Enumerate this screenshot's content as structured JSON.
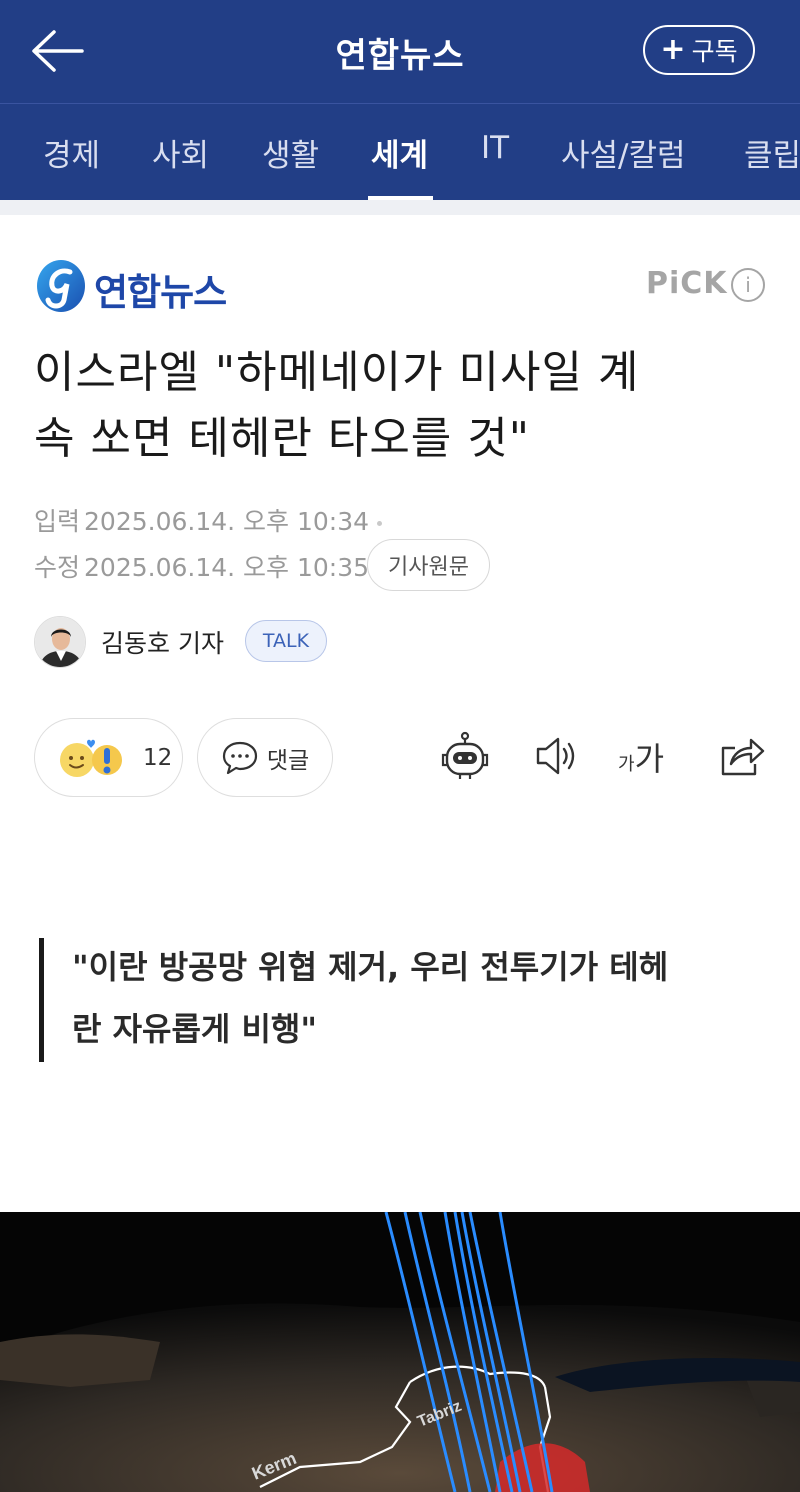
{
  "header": {
    "back_icon": "arrow-left-icon",
    "title": "연합뉴스",
    "subscribe_label": "구독"
  },
  "tabs": [
    {
      "label": "경제",
      "active": false
    },
    {
      "label": "사회",
      "active": false
    },
    {
      "label": "생활",
      "active": false
    },
    {
      "label": "세계",
      "active": true
    },
    {
      "label": "IT",
      "active": false
    },
    {
      "label": "사설/칼럼",
      "active": false
    },
    {
      "label": "클립",
      "active": false
    }
  ],
  "article": {
    "publisher": "연합뉴스",
    "pick_label": "PiCK",
    "pick_info": "i",
    "headline_line1": "이스라엘 \"하메네이가 미사일 계",
    "headline_line2": "속 쏘면 테헤란 타오를 것\"",
    "input_label": "입력",
    "input_time": "2025.06.14. 오후 10:34",
    "modified_label": "수정",
    "modified_time": "2025.06.14. 오후 10:35",
    "original_label": "기사원문",
    "reporter": "김동호 기자",
    "talk_label": "TALK",
    "reaction_count": "12",
    "comment_label": "댓글",
    "font_small": "가",
    "font_big": "가",
    "quote_line1": "\"이란 방공망 위협 제거, 우리 전투기가 테헤",
    "quote_line2": "란 자유롭게 비행\"",
    "map_labels": [
      "Tabriz",
      "Kerm"
    ]
  },
  "colors": {
    "header_bg": "#223e86",
    "publisher_blue": "#1e47a8",
    "flight_path": "#2a8cff",
    "highlight_red": "#d42a2a"
  }
}
